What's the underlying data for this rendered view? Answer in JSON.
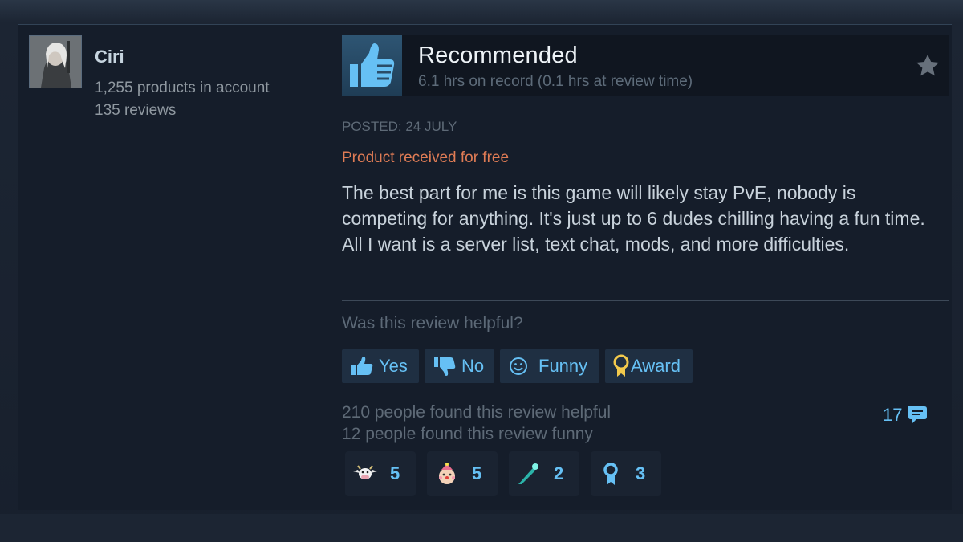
{
  "author": {
    "name": "Ciri",
    "products": "1,255 products in account",
    "reviews": "135 reviews"
  },
  "review": {
    "verdict": "Recommended",
    "hours": "6.1 hrs on record (0.1 hrs at review time)",
    "posted": "POSTED: 24 JULY",
    "free_note": "Product received for free",
    "text": "The best part for me is this game will likely stay PvE, nobody is competing for anything. It's just up to 6 dudes chilling having a fun time. All I want is a server list, text chat, mods, and more difficulties."
  },
  "feedback": {
    "question": "Was this review helpful?",
    "buttons": {
      "yes": "Yes",
      "no": "No",
      "funny": "Funny",
      "award": "Award"
    },
    "helpful_count": "210 people found this review helpful",
    "funny_count": "12 people found this review funny",
    "comments": "17"
  },
  "awards": [
    {
      "icon": "cow-award-icon",
      "count": "5"
    },
    {
      "icon": "clown-award-icon",
      "count": "5"
    },
    {
      "icon": "comet-award-icon",
      "count": "2"
    },
    {
      "icon": "ribbon-award-icon",
      "count": "3"
    }
  ],
  "colors": {
    "accent": "#66c0f4",
    "free_note": "#e07c55",
    "card_bg": "#151d2a"
  }
}
